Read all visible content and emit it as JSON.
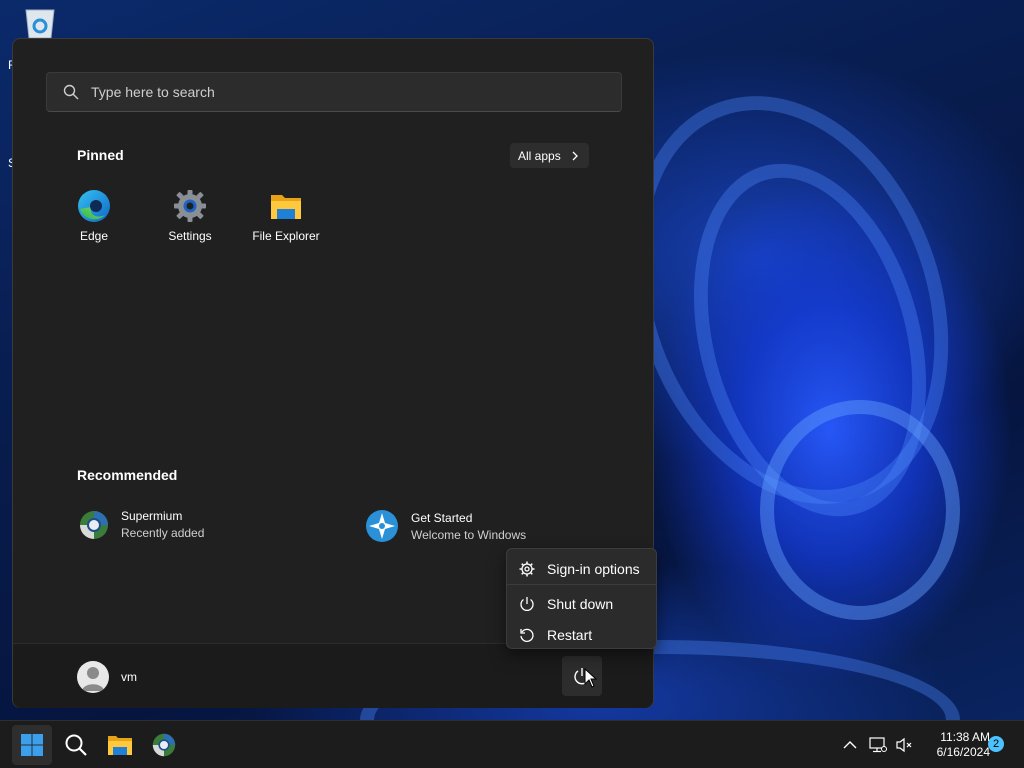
{
  "desktop": {
    "labels": [
      "R",
      "S"
    ]
  },
  "start_menu": {
    "search_placeholder": "Type here to search",
    "pinned_title": "Pinned",
    "all_apps_label": "All apps",
    "pinned": [
      {
        "label": "Edge",
        "icon": "edge-icon"
      },
      {
        "label": "Settings",
        "icon": "gear-icon"
      },
      {
        "label": "File Explorer",
        "icon": "folder-icon"
      }
    ],
    "recommended_title": "Recommended",
    "recommended": [
      {
        "title": "Supermium",
        "subtitle": "Recently added",
        "icon": "supermium-icon"
      },
      {
        "title": "Get Started",
        "subtitle": "Welcome to Windows",
        "icon": "get-started-icon"
      }
    ],
    "user_name": "vm"
  },
  "power_menu": {
    "items": [
      {
        "label": "Sign-in options",
        "icon": "gear-icon"
      },
      {
        "label": "Shut down",
        "icon": "power-icon"
      },
      {
        "label": "Restart",
        "icon": "restart-icon"
      }
    ]
  },
  "taskbar": {
    "apps": [
      "start-icon",
      "search-icon",
      "folder-icon",
      "supermium-icon"
    ],
    "clock_time": "11:38 AM",
    "clock_date": "6/16/2024",
    "notification_count": "2"
  },
  "colors": {
    "menu_bg": "#202020",
    "accent": "#4cc2ff",
    "wallpaper_blue": "#1e50e6"
  }
}
